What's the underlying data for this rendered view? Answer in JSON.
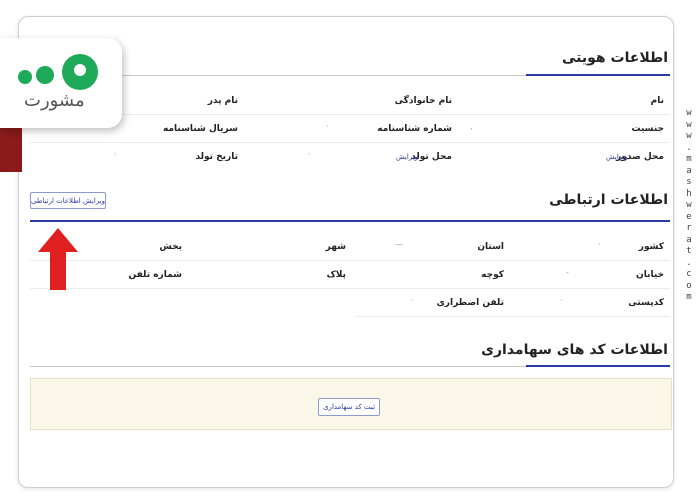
{
  "brand": {
    "logo_text": "مشورت",
    "watermark": "www.mashwerat.com",
    "colors": {
      "accent": "#2a3aa8",
      "logo_green": "#1faa5a",
      "arrow_red": "#e02020",
      "box_bg": "#fbf7e8"
    }
  },
  "identity": {
    "title": "اطلاعات هویتی",
    "fields": {
      "name": "نام",
      "family": "نام خانوادگی",
      "father": "نام پدر",
      "gender": "جنسیت",
      "id_number": "شماره شناسنامه",
      "id_serial": "سریال شناسنامه",
      "issue_place": "محل صدور",
      "birth_place": "محل تولد",
      "birth_date": "تاریخ تولد"
    },
    "edit_label": "ویرایش"
  },
  "contact": {
    "title": "اطلاعات ارتباطی",
    "edit_button": "ویرایش اطلاعات ارتباطی",
    "fields": {
      "country": "کشور",
      "province": "استان",
      "city": "شهر",
      "district": "بخش",
      "street": "خیابان",
      "alley": "کوچه",
      "plate": "پلاک",
      "phone": "شماره تلفن",
      "postal": "کدپستی",
      "emergency": "تلفن اضطراری"
    }
  },
  "stock": {
    "title": "اطلاعات کد های سهامداری",
    "register_button": "ثبت کد سهامداری"
  },
  "icons": {
    "arrow": "red-up-arrow-icon",
    "dots": "green-dots-logo-icon"
  }
}
